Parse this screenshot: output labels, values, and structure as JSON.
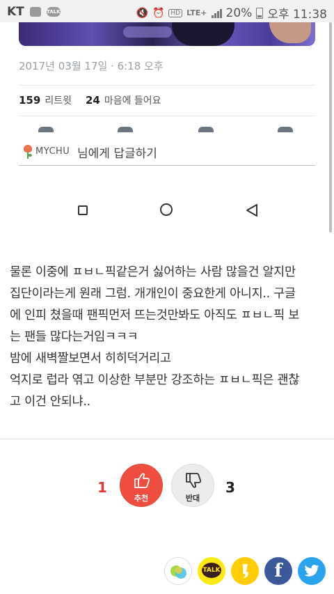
{
  "status_bar": {
    "carrier": "KT",
    "hd_badge": "HD",
    "network": "LTE+",
    "battery": "20%",
    "time": "오후 11:38",
    "icons": [
      "image-icon",
      "talk-icon",
      "mute-icon",
      "alarm-icon",
      "signal-icon",
      "battery-icon"
    ]
  },
  "tweet": {
    "date": "2017년 03월 17일 · 6:18 오후",
    "retweets_count": "159",
    "retweets_label": "리트윗",
    "likes_count": "24",
    "likes_label": "마음에 들어요",
    "actions": [
      "reply-icon",
      "retweet-icon",
      "heart-icon",
      "message-icon"
    ]
  },
  "reply": {
    "username": "MYCHU",
    "text": "님에게 답글하기"
  },
  "nav": {
    "buttons": [
      "recent-apps-button",
      "home-button",
      "back-button"
    ]
  },
  "post": {
    "lines": [
      "물론 이중에 ㅍㅂㄴ픽같은거 싫어하는 사람 많을건 알지만",
      "집단이라는게 원래 그럼. 개개인이 중요한게 아니지.. 구글",
      "에 인피 쳤을때 팬픽먼저 뜨는것만봐도 아직도 ㅍㅂㄴ픽 보",
      "는 팬들 많다는거임ㅋㅋㅋ",
      "밤에 새벽짤보면서 히히덕거리고",
      "억지로 럽라 엮고 이상한 부분만 강조하는 ㅍㅂㄴ픽은 괜찮",
      "고 이건 안되냐.."
    ]
  },
  "vote": {
    "up_count": "1",
    "up_label": "추천",
    "down_count": "3",
    "down_label": "반대"
  },
  "share": {
    "talk_label": "TALK",
    "facebook_glyph": "f",
    "items": [
      "kakao-story-share",
      "kakaotalk-share",
      "kakaostory-share",
      "facebook-share",
      "twitter-share"
    ]
  },
  "colors": {
    "upvote": "#ef4d3f",
    "downvote_bg": "#ececec",
    "facebook": "#3b5998",
    "twitter": "#2aa3ef",
    "kakao": "#ffe812"
  }
}
